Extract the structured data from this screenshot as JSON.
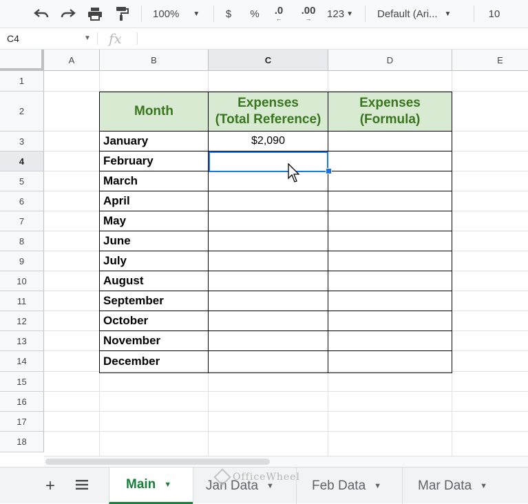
{
  "toolbar": {
    "zoom": "100%",
    "currency": "$",
    "percent": "%",
    "dec_less": ".0",
    "dec_more": ".00",
    "format_more": "123",
    "font": "Default (Ari...",
    "font_size": "10"
  },
  "formula_bar": {
    "cell_ref": "C4",
    "fx": "fx",
    "value": ""
  },
  "columns": [
    "A",
    "B",
    "C",
    "D",
    "E"
  ],
  "rows": [
    "1",
    "2",
    "3",
    "4",
    "5",
    "6",
    "7",
    "8",
    "9",
    "10",
    "11",
    "12",
    "13",
    "14",
    "15",
    "16",
    "17",
    "18"
  ],
  "selected": {
    "column": "C",
    "row": "4"
  },
  "table": {
    "header": {
      "month": "Month",
      "expenses_total_ref": "Expenses\n(Total Reference)",
      "expenses_formula": "Expenses\n(Formula)"
    },
    "months": [
      "January",
      "February",
      "March",
      "April",
      "May",
      "June",
      "July",
      "August",
      "September",
      "October",
      "November",
      "December"
    ],
    "total_ref_values": [
      "$2,090",
      "",
      "",
      "",
      "",
      "",
      "",
      "",
      "",
      "",
      "",
      ""
    ],
    "formula_values": [
      "",
      "",
      "",
      "",
      "",
      "",
      "",
      "",
      "",
      "",
      "",
      ""
    ]
  },
  "sheets": {
    "tabs": [
      "Main",
      "Jan Data",
      "Feb Data",
      "Mar Data"
    ],
    "active": "Main"
  },
  "watermark": "OfficeWheel",
  "colors": {
    "header_fill": "#d9ead3",
    "header_text": "#38761d",
    "selection": "#1a73e8",
    "active_tab": "#188038"
  }
}
